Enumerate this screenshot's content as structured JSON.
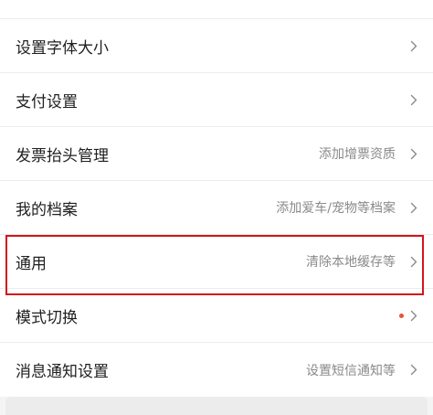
{
  "settings": {
    "rows": [
      {
        "label": "设置字体大小",
        "value": ""
      },
      {
        "label": "支付设置",
        "value": ""
      },
      {
        "label": "发票抬头管理",
        "value": "添加增票资质"
      },
      {
        "label": "我的档案",
        "value": "添加爱车/宠物等档案"
      },
      {
        "label": "通用",
        "value": "清除本地缓存等"
      },
      {
        "label": "模式切换",
        "value": ""
      },
      {
        "label": "消息通知设置",
        "value": "设置短信通知等"
      }
    ]
  },
  "colors": {
    "highlight": "#d3141a",
    "dot": "#e4572e"
  },
  "icons": {
    "chevron": "chevron-right-icon",
    "dot": "notification-dot-icon"
  }
}
